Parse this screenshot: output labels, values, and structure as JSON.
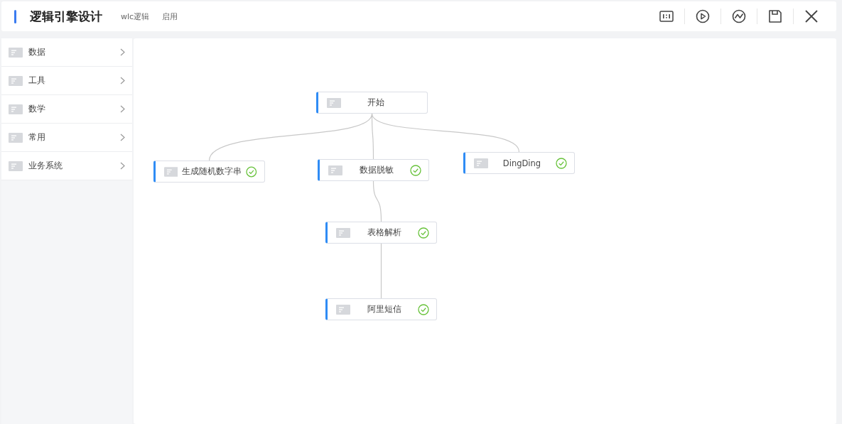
{
  "header": {
    "title": "逻辑引擎设计",
    "subtitle": "wlc逻辑",
    "status": "启用"
  },
  "sidebar": {
    "items": [
      {
        "label": "数据"
      },
      {
        "label": "工具"
      },
      {
        "label": "数学"
      },
      {
        "label": "常用"
      },
      {
        "label": "业务系统"
      }
    ]
  },
  "flow": {
    "root": {
      "label": "开始",
      "children": [
        {
          "label": "生成随机数字串",
          "done": true
        },
        {
          "label": "数据脱敏",
          "done": true,
          "children": [
            {
              "label": "表格解析",
              "done": true,
              "children": [
                {
                  "label": "阿里短信",
                  "done": true
                }
              ]
            }
          ]
        },
        {
          "label": "DingDing",
          "done": true
        }
      ]
    }
  }
}
